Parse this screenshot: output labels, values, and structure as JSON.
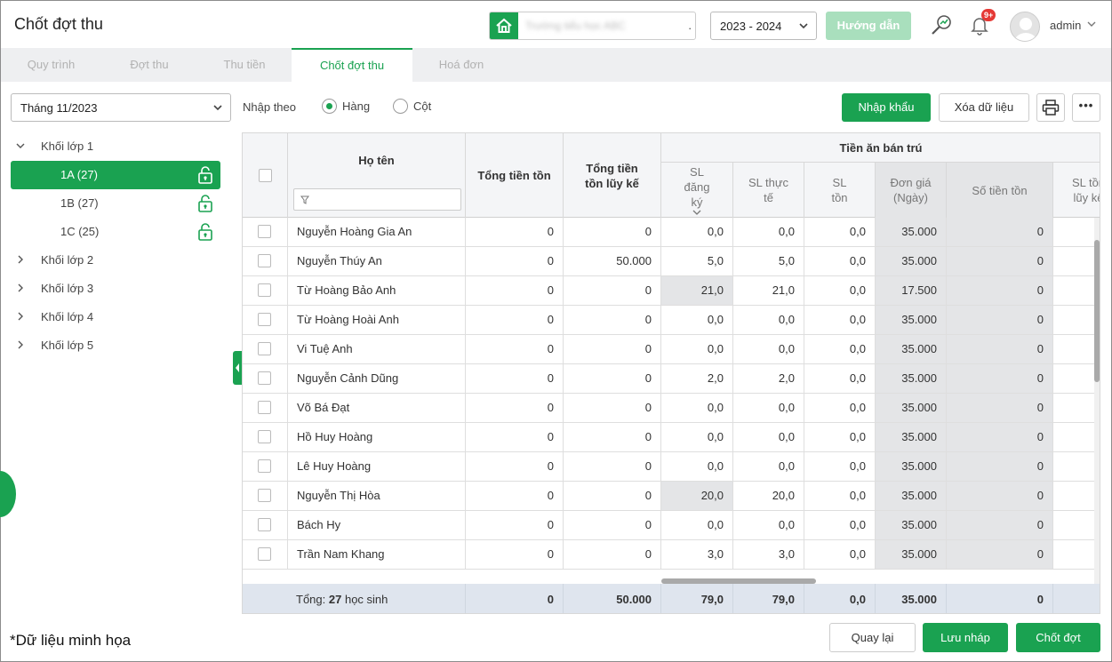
{
  "header": {
    "title": "Chốt đợt thu",
    "school_name": "Trường tiểu học ABC",
    "year": "2023 - 2024",
    "guide_label": "Hướng dẫn",
    "notification_count": "9+",
    "user": "admin"
  },
  "tabs": [
    {
      "label": "Quy trình"
    },
    {
      "label": "Đợt thu"
    },
    {
      "label": "Thu tiền"
    },
    {
      "label": "Chốt đợt thu"
    },
    {
      "label": "Hoá đơn"
    }
  ],
  "filter": {
    "month": "Tháng 11/2023"
  },
  "tree": {
    "grade1": "Khối lớp 1",
    "classes": [
      {
        "label": "1A (27)"
      },
      {
        "label": "1B (27)"
      },
      {
        "label": "1C (25)"
      }
    ],
    "grade2": "Khối lớp 2",
    "grade3": "Khối lớp 3",
    "grade4": "Khối lớp 4",
    "grade5": "Khối lớp 5"
  },
  "toolbar": {
    "input_by_label": "Nhập theo",
    "radio_row": "Hàng",
    "radio_col": "Cột",
    "import_label": "Nhập khẩu",
    "clear_label": "Xóa dữ liệu"
  },
  "table": {
    "headers": {
      "name": "Họ tên",
      "total_balance": "Tổng tiền tồn",
      "total_cumulative": "Tổng tiền tồn lũy kế",
      "group": "Tiền ăn bán trú",
      "sl_registered": "SL đăng ký",
      "sl_actual": "SL thực tế",
      "sl_balance": "SL tồn",
      "unit_price": "Đơn giá (Ngày)",
      "balance_amount": "Số tiền tồn",
      "sl_cumulative": "SL tồn lũy kế"
    },
    "rows": [
      {
        "name": "Nguyễn Hoàng Gia An",
        "ttt": "0",
        "tttlk": "0",
        "sldk": "0,0",
        "sltt": "0,0",
        "slt": "0,0",
        "dg": "35.000",
        "stt": "0"
      },
      {
        "name": "Nguyễn Thúy An",
        "ttt": "0",
        "tttlk": "50.000",
        "sldk": "5,0",
        "sltt": "5,0",
        "slt": "0,0",
        "dg": "35.000",
        "stt": "0"
      },
      {
        "name": "Từ Hoàng Bảo Anh",
        "ttt": "0",
        "tttlk": "0",
        "sldk": "21,0",
        "sltt": "21,0",
        "slt": "0,0",
        "dg": "17.500",
        "stt": "0"
      },
      {
        "name": "Từ Hoàng Hoài Anh",
        "ttt": "0",
        "tttlk": "0",
        "sldk": "0,0",
        "sltt": "0,0",
        "slt": "0,0",
        "dg": "35.000",
        "stt": "0"
      },
      {
        "name": "Vi Tuệ Anh",
        "ttt": "0",
        "tttlk": "0",
        "sldk": "0,0",
        "sltt": "0,0",
        "slt": "0,0",
        "dg": "35.000",
        "stt": "0"
      },
      {
        "name": "Nguyễn Cảnh Dũng",
        "ttt": "0",
        "tttlk": "0",
        "sldk": "2,0",
        "sltt": "2,0",
        "slt": "0,0",
        "dg": "35.000",
        "stt": "0"
      },
      {
        "name": "Võ Bá Đạt",
        "ttt": "0",
        "tttlk": "0",
        "sldk": "0,0",
        "sltt": "0,0",
        "slt": "0,0",
        "dg": "35.000",
        "stt": "0"
      },
      {
        "name": "Hồ Huy Hoàng",
        "ttt": "0",
        "tttlk": "0",
        "sldk": "0,0",
        "sltt": "0,0",
        "slt": "0,0",
        "dg": "35.000",
        "stt": "0"
      },
      {
        "name": "Lê Huy Hoàng",
        "ttt": "0",
        "tttlk": "0",
        "sldk": "0,0",
        "sltt": "0,0",
        "slt": "0,0",
        "dg": "35.000",
        "stt": "0"
      },
      {
        "name": "Nguyễn Thị Hòa",
        "ttt": "0",
        "tttlk": "0",
        "sldk": "20,0",
        "sltt": "20,0",
        "slt": "0,0",
        "dg": "35.000",
        "stt": "0"
      },
      {
        "name": "Bách Hy",
        "ttt": "0",
        "tttlk": "0",
        "sldk": "0,0",
        "sltt": "0,0",
        "slt": "0,0",
        "dg": "35.000",
        "stt": "0"
      },
      {
        "name": "Trần Nam Khang",
        "ttt": "0",
        "tttlk": "0",
        "sldk": "3,0",
        "sltt": "3,0",
        "slt": "0,0",
        "dg": "35.000",
        "stt": "0"
      }
    ],
    "footer": {
      "label_prefix": "Tổng:",
      "count": "27",
      "label_suffix": "học sinh",
      "ttt": "0",
      "tttlk": "50.000",
      "sldk": "79,0",
      "sltt": "79,0",
      "slt": "0,0",
      "dg": "35.000",
      "stt": "0"
    }
  },
  "actions": {
    "back": "Quay lại",
    "save_draft": "Lưu nháp",
    "close_period": "Chốt đợt"
  },
  "note": "*Dữ liệu minh họa",
  "colors": {
    "accent": "#1aa251",
    "footer_bg": "#dfe5ee"
  }
}
